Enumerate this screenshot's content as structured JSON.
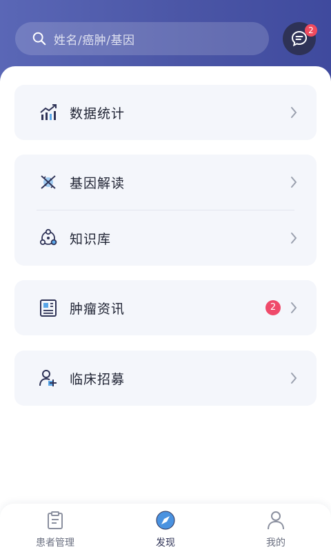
{
  "search": {
    "placeholder": "姓名/癌肿/基因",
    "icon": "search-icon"
  },
  "messages": {
    "badge": "2",
    "icon": "message-icon"
  },
  "menu": {
    "statistics": {
      "label": "数据统计",
      "icon": "chart-growth-icon"
    },
    "gene": {
      "label": "基因解读",
      "icon": "dna-icon"
    },
    "knowledge": {
      "label": "知识库",
      "icon": "knowledge-network-icon"
    },
    "news": {
      "label": "肿瘤资讯",
      "icon": "newspaper-icon",
      "badge": "2"
    },
    "recruit": {
      "label": "临床招募",
      "icon": "add-user-icon"
    }
  },
  "tabs": [
    {
      "label": "患者管理",
      "icon": "clipboard-icon",
      "active": false
    },
    {
      "label": "发现",
      "icon": "compass-icon",
      "active": true
    },
    {
      "label": "我的",
      "icon": "person-icon",
      "active": false
    }
  ],
  "colors": {
    "header": "#4b56a6",
    "badge": "#ef4a5e",
    "card": "#f4f6fb",
    "accent": "#5aa6e8",
    "dark": "#2e3256"
  }
}
